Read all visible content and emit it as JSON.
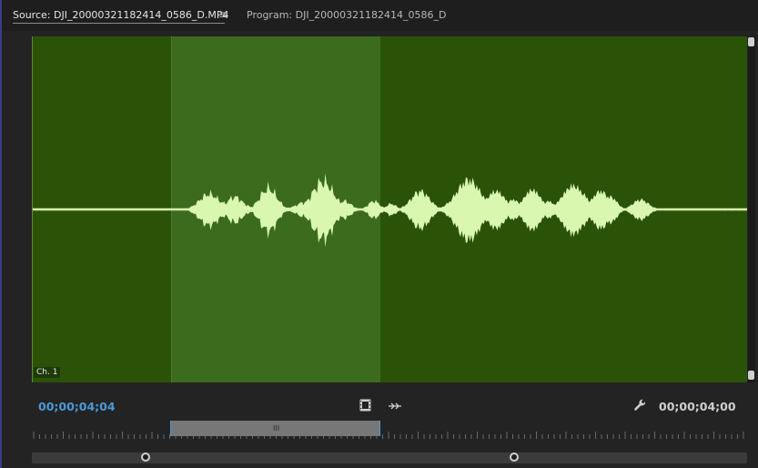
{
  "tabs": {
    "source_label": "Source: DJI_20000321182414_0586_D.MP4",
    "menu_icon": "≡",
    "program_label": "Program: DJI_20000321182414_0586_D"
  },
  "monitor": {
    "channel_label": "Ch. 1",
    "waveform_color": "#d9f7ae",
    "background_color": "#2a5308",
    "inout_region_color": "#3d6b1e"
  },
  "controls": {
    "playhead_timecode": "00;00;04;04",
    "duration_timecode": "00;00;04;00",
    "film_icon": "drag-video-icon",
    "shuttle_icon": "drag-audio-icon",
    "wrench_icon": "settings-wrench-icon",
    "ruler_grip": "III"
  },
  "colors": {
    "accent_blue": "#4b9ad8",
    "panel_bg": "#232323"
  }
}
